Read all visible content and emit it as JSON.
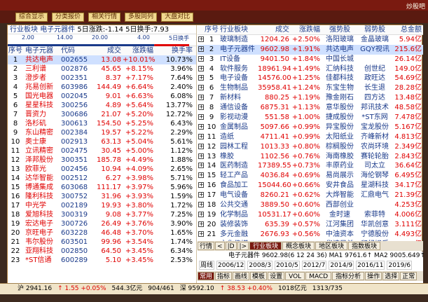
{
  "window": {
    "title": "",
    "logo": "炒股吧"
  },
  "toolbar": {
    "buttons": [
      "综合显示",
      "分类报价",
      "相关行情",
      "多股同列",
      "大盘对比"
    ]
  },
  "left": {
    "header": {
      "label": "行业板块",
      "name": "电子元器件",
      "stats": "5日涨跌:-1.14 5日换手:7.93"
    },
    "spark_ticks": [
      "2.00",
      "14.00",
      "20.00",
      "4.00",
      "5日换手"
    ],
    "columns": [
      "序号",
      "电子元器",
      "代码",
      "成交",
      "涨跌幅",
      "换手率"
    ],
    "rows": [
      [
        "1",
        "共达电声",
        "002655",
        "13.08",
        "+10.01%",
        "10.73%"
      ],
      [
        "2",
        "三利谱",
        "002876",
        "45.65",
        "+8.15%",
        "3.96%"
      ],
      [
        "3",
        "澄步者",
        "002351",
        "8.37",
        "+7.17%",
        "7.64%"
      ],
      [
        "4",
        "兆易创新",
        "603986",
        "144.49",
        "+6.64%",
        "2.40%"
      ],
      [
        "5",
        "国光电器",
        "002045",
        "9.01",
        "+6.63%",
        "6.08%"
      ],
      [
        "6",
        "星星科技",
        "300256",
        "4.89",
        "+5.64%",
        "13.77%"
      ],
      [
        "7",
        "晋资力",
        "300686",
        "21.07",
        "+5.20%",
        "12.72%"
      ],
      [
        "8",
        "洛杉矶",
        "300613",
        "154.50",
        "+5.25%",
        "6.43%"
      ],
      [
        "9",
        "东山精密",
        "002384",
        "19.57",
        "+5.22%",
        "2.29%"
      ],
      [
        "10",
        "奥士康",
        "002913",
        "63.13",
        "+5.04%",
        "5.61%"
      ],
      [
        "11",
        "立讯精密",
        "002475",
        "30.45",
        "+5.00%",
        "1.12%"
      ],
      [
        "12",
        "泽邦股份",
        "300351",
        "185.78",
        "+4.49%",
        "1.88%"
      ],
      [
        "13",
        "欧菲光",
        "002456",
        "10.94",
        "+4.09%",
        "2.65%"
      ],
      [
        "14",
        "达华智能",
        "002512",
        "6.27",
        "+3.98%",
        "5.71%"
      ],
      [
        "15",
        "博通集成",
        "603068",
        "111.17",
        "+3.97%",
        "5.96%"
      ],
      [
        "16",
        "隆利科技",
        "300752",
        "31.96",
        "+3.93%",
        "1.59%"
      ],
      [
        "17",
        "中光学",
        "002189",
        "19.93",
        "+3.80%",
        "1.72%"
      ],
      [
        "18",
        "爱旭科技",
        "300319",
        "9.08",
        "+3.77%",
        "7.25%"
      ],
      [
        "19",
        "宏达电子",
        "300726",
        "26.49",
        "+3.76%",
        "3.90%"
      ],
      [
        "20",
        "京旺电子",
        "603228",
        "46.48",
        "+3.70%",
        "1.65%"
      ],
      [
        "21",
        "韦尔股份",
        "603501",
        "99.96",
        "+3.54%",
        "1.74%"
      ],
      [
        "22",
        "亚翔科技",
        "002850",
        "64.50",
        "+3.45%",
        "6.34%"
      ],
      [
        "23",
        "*ST信通",
        "600289",
        "5.10",
        "+3.45%",
        "2.53%"
      ]
    ],
    "tabs": [
      "行情",
      "<",
      "|D",
      "|>",
      "行业板块",
      "普通主板"
    ]
  },
  "right": {
    "columns": [
      "序号",
      "行业板块",
      "成交",
      "涨跌幅",
      "强势股",
      "弱势股",
      "总金额"
    ],
    "rows": [
      [
        "1",
        "玻璃制造",
        "1204.26",
        "+2.50%",
        "洛阳玻璃",
        "金晶玻璃",
        "5.94亿"
      ],
      [
        "2",
        "电子元器件",
        "9602.98",
        "+1.91%",
        "共达电声",
        "GQY视讯",
        "215.6亿"
      ],
      [
        "3",
        "IT设备",
        "9401.50",
        "+1.84%",
        "中国长城",
        "",
        "26.14亿"
      ],
      [
        "4",
        "软件服务",
        "18961.94",
        "+1.49%",
        "汇纳科技",
        "创世纪",
        "149.0亿"
      ],
      [
        "5",
        "电子设备",
        "14576.00",
        "+1.25%",
        "佳都科技",
        "政旺达",
        "54.69亿"
      ],
      [
        "6",
        "生物制品",
        "35958.41",
        "+1.24%",
        "东宝生物",
        "长生退",
        "28.28亿"
      ],
      [
        "7",
        "新材料",
        "880.25",
        "+1.19%",
        "豫金刚石",
        "四方达",
        "13.48亿"
      ],
      [
        "8",
        "通信设备",
        "6875.31",
        "+1.13%",
        "意华股份",
        "邦讯技术",
        "48.58亿"
      ],
      [
        "9",
        "影视动漫",
        "551.58",
        "+1.00%",
        "捷成股份",
        "*ST东网",
        "7.478亿"
      ],
      [
        "10",
        "金属制品",
        "5097.66",
        "+0.99%",
        "异宝股份",
        "宝龙股份",
        "5.167亿"
      ],
      [
        "11",
        "造纸",
        "4711.41",
        "+0.99%",
        "太阳纸业",
        "齐峰新材",
        "4.813亿"
      ],
      [
        "12",
        "园林工程",
        "1013.33",
        "+0.80%",
        "棕榈股份",
        "农尚环境",
        "2.349亿"
      ],
      [
        "13",
        "橡胶",
        "1102.56",
        "+0.76%",
        "海南橡胶",
        "赛轮轮胎",
        "2.843亿"
      ],
      [
        "14",
        "医药制造",
        "17389.55",
        "+0.73%",
        "丰原药业",
        "司太立",
        "36.64亿"
      ],
      [
        "15",
        "轻工产品",
        "4036.84",
        "+0.69%",
        "易尚展示",
        "海伦钢琴",
        "6.495亿"
      ],
      [
        "16",
        "食品加工",
        "15044.60",
        "+0.66%",
        "安井食品",
        "星湖科技",
        "34.17亿"
      ],
      [
        "17",
        "电气设备",
        "8260.21",
        "+0.62%",
        "大烨智能",
        "汇鼎电气",
        "21.39亿"
      ],
      [
        "18",
        "公共交通",
        "3889.50",
        "+0.60%",
        "西部创业",
        "",
        "4.253亿"
      ],
      [
        "19",
        "化学制品",
        "10531.17",
        "+0.60%",
        "金时速",
        "索菲特",
        "4.006亿"
      ],
      [
        "20",
        "装修装饰",
        "635.39",
        "+0.57%",
        "江河集团",
        "华凯创意",
        "3.111亿"
      ],
      [
        "21",
        "多元金融",
        "2676.93",
        "+0.56%",
        "中油资本",
        "宁德股份",
        "4.493亿"
      ],
      [
        "22",
        "文化传媒",
        "4480.52",
        "+0.56%",
        "华谊兄弟",
        "印纪娱乐",
        "21.43亿"
      ]
    ],
    "tabs": [
      "行情",
      "<",
      "|D",
      "|>",
      "行业板块",
      "概念板块",
      "地区板块",
      "指数板块"
    ]
  },
  "ticker": {
    "line1": "电子元器件 9602.98(6 12 24 36) MA1 9761.6↑ MA2 9005.649↑",
    "cycle_label": "周线",
    "dates": [
      "2006/12",
      "2008/3",
      "2010/5",
      "2012/7",
      "2014/9",
      "2016/11",
      "2019/6"
    ],
    "tabs": [
      "常用",
      "指标",
      "画线",
      "模板",
      "设置",
      "VOL",
      "MACD",
      "指标分析",
      "操作",
      "选择",
      "正常"
    ]
  },
  "status": {
    "sh": "沪  2941.16",
    "sh_chg": "↑ 1.55 +0.05%",
    "sh_amt": "544.3亿元",
    "sh_ud": "904/461",
    "sz": "深  9592.10",
    "sz_chg": "↑ 38.53 +0.40%",
    "sz_amt": "1018亿元",
    "sz_ud": "1313/735"
  },
  "colors": {
    "accent": "#7a1a10",
    "up": "#e00000",
    "blue": "#1a3a8a"
  }
}
